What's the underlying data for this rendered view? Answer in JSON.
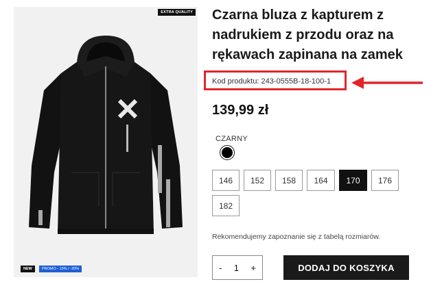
{
  "product": {
    "title": "Czarna bluza z kapturem z nadrukiem z przodu oraz na rękawach zapinana na zamek",
    "code_label": "Kod produktu: 243-0555B-18-100-1",
    "price": "139,99 zł",
    "color_name": "CZARNY",
    "sizes": [
      "146",
      "152",
      "158",
      "164",
      "170",
      "176",
      "182"
    ],
    "selected_size": "170",
    "size_note": "Rekomendujemy zapoznanie się z tabelą rozmiarów.",
    "quantity": "1",
    "add_to_cart": "DODAJ DO KOSZYKA"
  },
  "badges": {
    "quality": "EXTRA QUALITY",
    "new": "NEW",
    "promo": "PROMO - 15% / -20%"
  },
  "qty_controls": {
    "minus": "-",
    "plus": "+"
  },
  "colors": {
    "highlight": "#e0262b",
    "promo": "#1f5fd6",
    "button": "#1a1a1a"
  }
}
